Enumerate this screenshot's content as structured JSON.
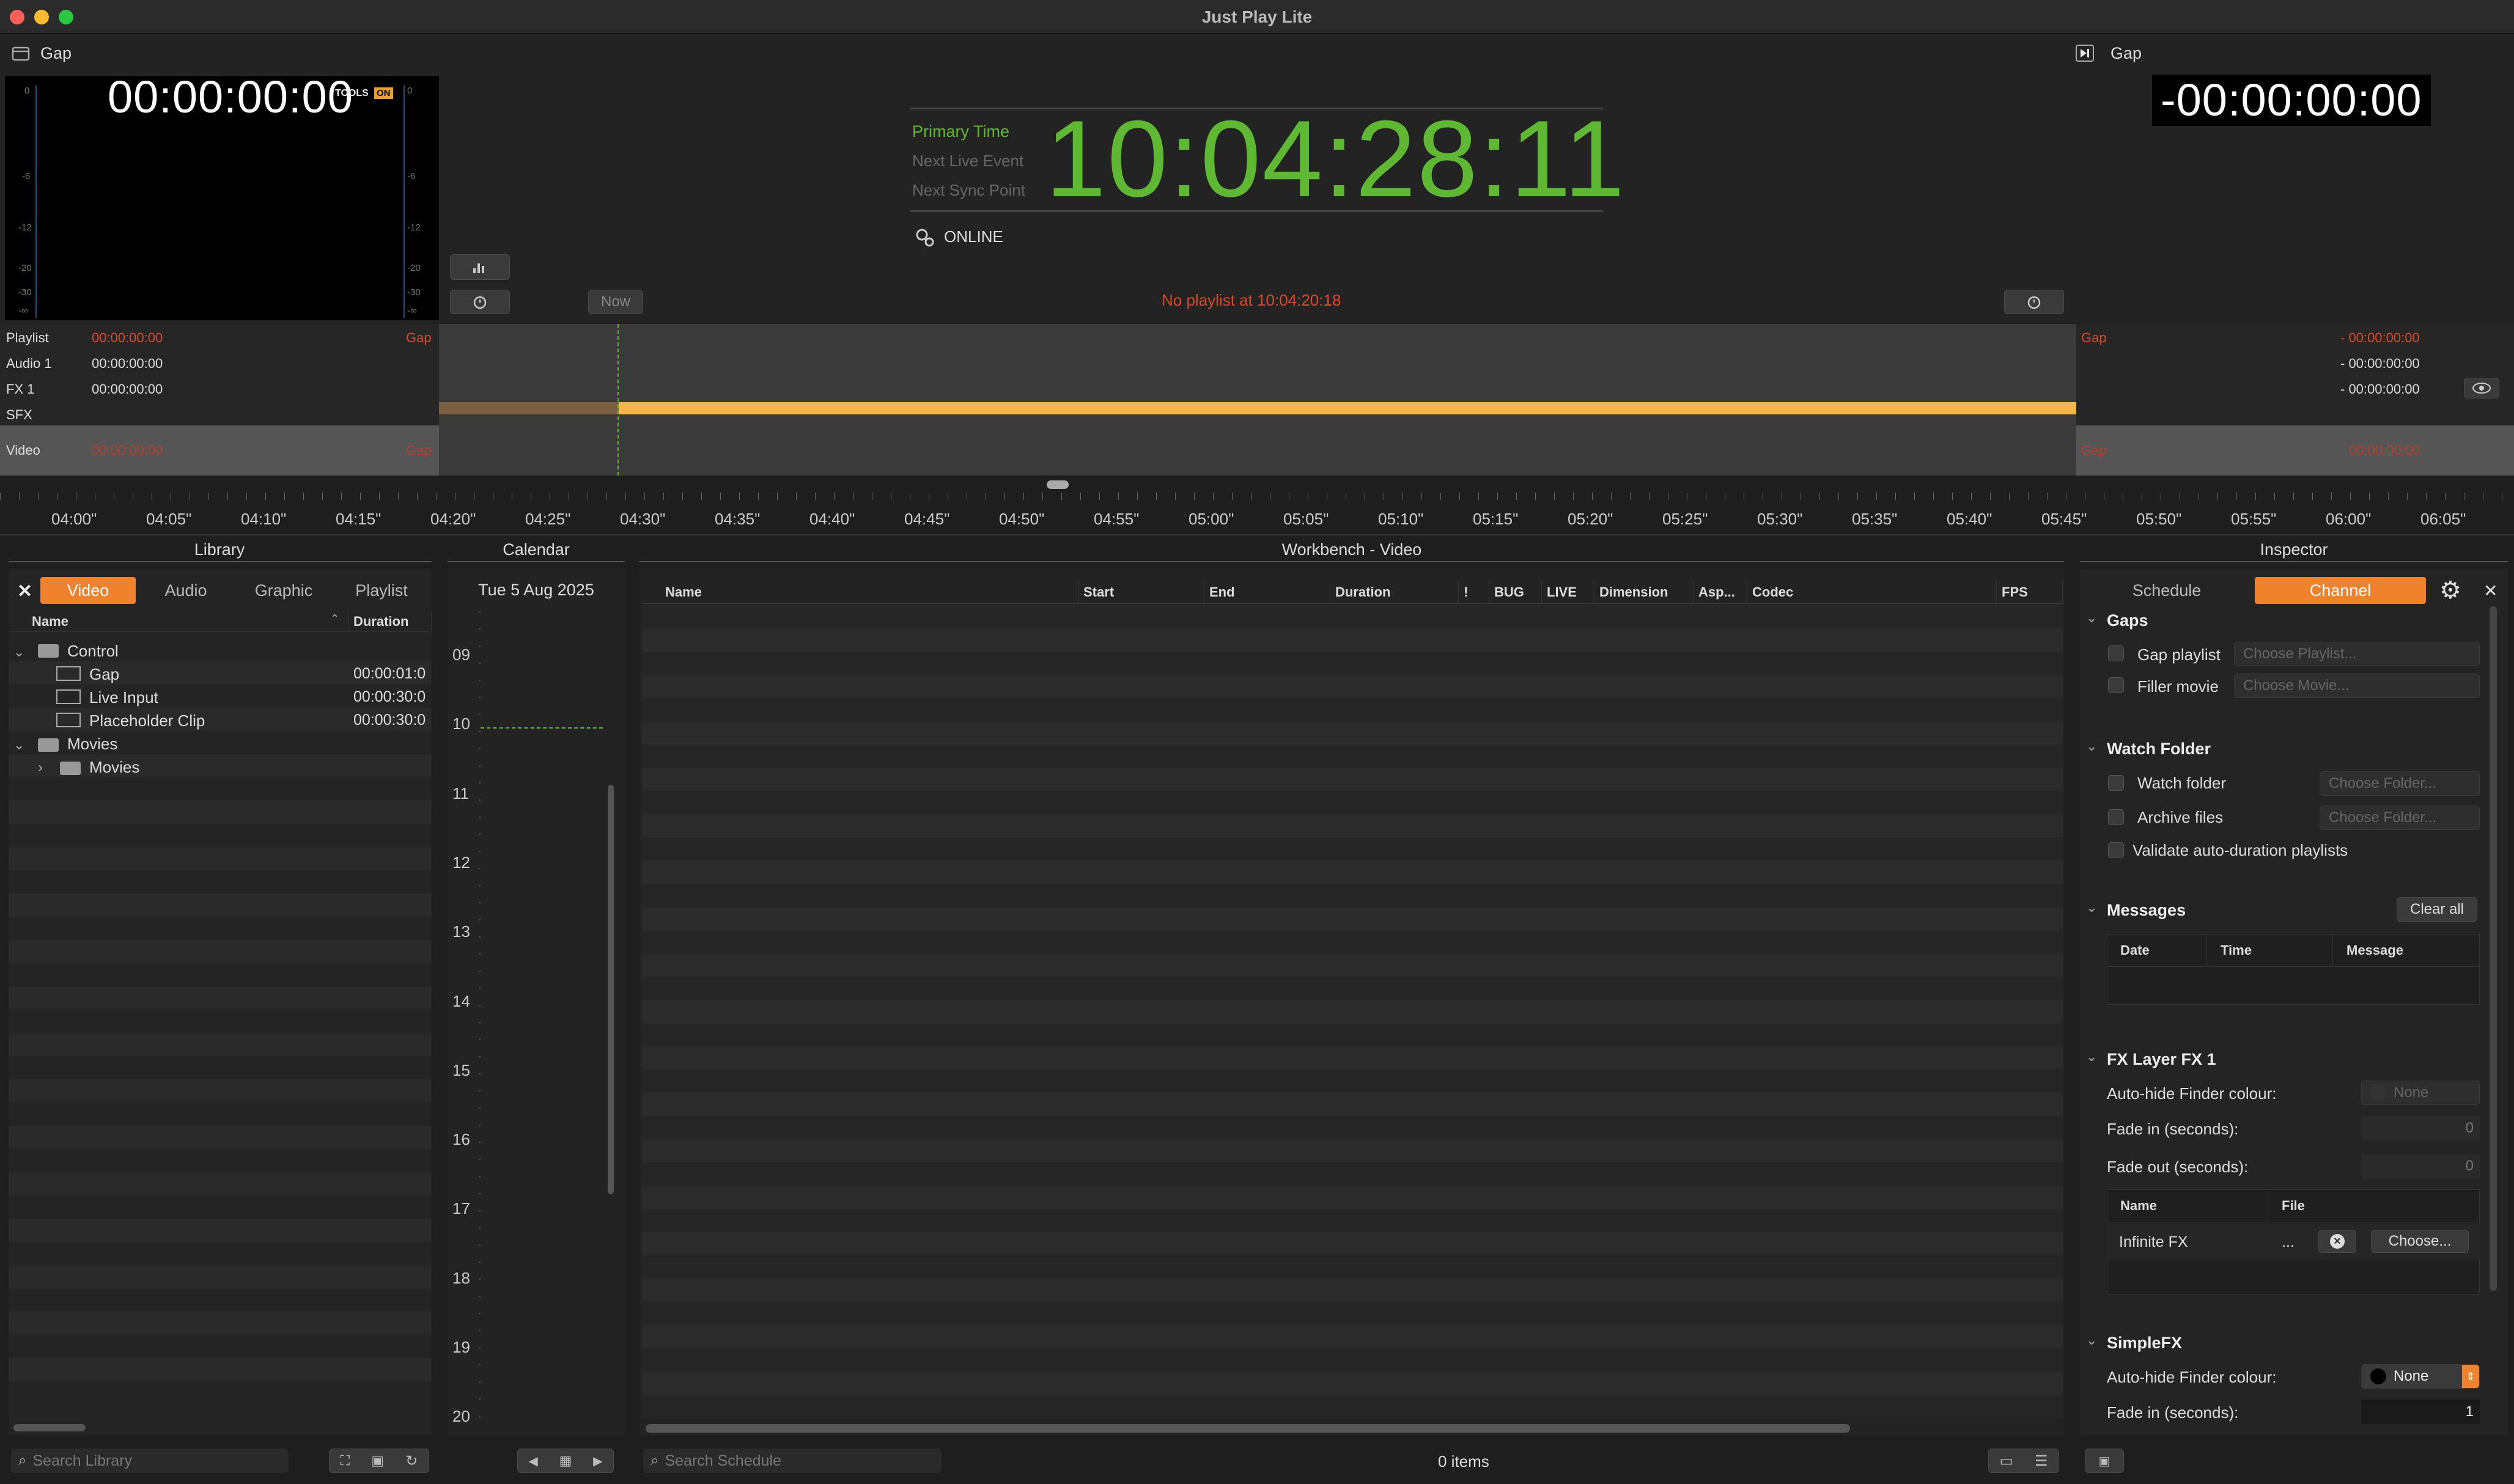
{
  "app": {
    "title": "Just Play Lite"
  },
  "header": {
    "left": {
      "label": "Gap",
      "timecode": "00:00:00:00",
      "tools": "TOOLS",
      "on": "ON",
      "scale": [
        "0",
        "-6",
        "-12",
        "-20",
        "-30",
        "-∞"
      ]
    },
    "center": {
      "primary_label": "Primary Time",
      "next_live_label": "Next Live Event",
      "next_sync_label": "Next Sync Point",
      "clock": "10:04:28:11",
      "status": "ONLINE"
    },
    "right": {
      "label": "Gap",
      "timecode": "-00:00:00:00"
    },
    "now_button": "Now",
    "no_playlist": "No playlist at 10:04:20:18"
  },
  "tracks": [
    {
      "name": "Playlist",
      "time": "00:00:00:00",
      "gap": "Gap",
      "right_gap": "Gap",
      "right_time": "- 00:00:00:00"
    },
    {
      "name": "Audio 1",
      "time": "00:00:00:00",
      "gap": "",
      "right_gap": "",
      "right_time": "- 00:00:00:00"
    },
    {
      "name": "FX 1",
      "time": "00:00:00:00",
      "gap": "",
      "right_gap": "",
      "right_time": "- 00:00:00:00"
    },
    {
      "name": "SFX",
      "time": "",
      "gap": "",
      "right_gap": "",
      "right_time": ""
    },
    {
      "name": "Video",
      "time": "00:00:00:00",
      "gap": "Gap",
      "right_gap": "Gap",
      "right_time": "00:00:00:00"
    }
  ],
  "ruler": [
    "04:00\"",
    "04:05\"",
    "04:10\"",
    "04:15\"",
    "04:20\"",
    "04:25\"",
    "04:30\"",
    "04:35\"",
    "04:40\"",
    "04:45\"",
    "04:50\"",
    "04:55\"",
    "05:00\"",
    "05:05\"",
    "05:10\"",
    "05:15\"",
    "05:20\"",
    "05:25\"",
    "05:30\"",
    "05:35\"",
    "05:40\"",
    "05:45\"",
    "05:50\"",
    "05:55\"",
    "06:00\"",
    "06:05\""
  ],
  "library": {
    "title": "Library",
    "tabs": [
      "Video",
      "Audio",
      "Graphic",
      "Playlist"
    ],
    "columns": [
      "Name",
      "Duration"
    ],
    "items": [
      {
        "name": "Control",
        "duration": ""
      },
      {
        "name": "Gap",
        "duration": "00:00:01:0"
      },
      {
        "name": "Live Input",
        "duration": "00:00:30:0"
      },
      {
        "name": "Placeholder Clip",
        "duration": "00:00:30:0"
      },
      {
        "name": "Movies",
        "duration": ""
      },
      {
        "name": "Movies",
        "duration": ""
      }
    ],
    "search_placeholder": "Search Library"
  },
  "calendar": {
    "title": "Calendar",
    "date": "Tue 5 Aug 2025",
    "hours": [
      "09",
      "10",
      "11",
      "12",
      "13",
      "14",
      "15",
      "16",
      "17",
      "18",
      "19",
      "20"
    ]
  },
  "workbench": {
    "title": "Workbench - Video",
    "columns": [
      "Name",
      "Start",
      "End",
      "Duration",
      "!",
      "BUG",
      "LIVE",
      "Dimension",
      "Asp...",
      "Codec",
      "FPS"
    ],
    "search_placeholder": "Search Schedule",
    "item_count": "0 items"
  },
  "inspector": {
    "title": "Inspector",
    "tabs": [
      "Schedule",
      "Channel"
    ],
    "gaps": {
      "title": "Gaps",
      "gap_playlist": "Gap playlist",
      "choose_playlist": "Choose Playlist...",
      "filler_movie": "Filler movie",
      "choose_movie": "Choose Movie..."
    },
    "watch": {
      "title": "Watch Folder",
      "watch_folder": "Watch folder",
      "choose_folder1": "Choose Folder...",
      "archive": "Archive files",
      "choose_folder2": "Choose Folder...",
      "validate": "Validate auto-duration playlists"
    },
    "messages": {
      "title": "Messages",
      "clear": "Clear all",
      "columns": [
        "Date",
        "Time",
        "Message"
      ]
    },
    "fx1": {
      "title": "FX Layer FX 1",
      "auto_hide": "Auto-hide Finder colour:",
      "none": "None",
      "fade_in": "Fade in (seconds):",
      "fade_in_val": "0",
      "fade_out": "Fade out (seconds):",
      "fade_out_val": "0",
      "columns": [
        "Name",
        "File"
      ],
      "row_name": "Infinite FX",
      "row_dots": "...",
      "choose": "Choose..."
    },
    "simplefx": {
      "title": "SimpleFX",
      "auto_hide": "Auto-hide Finder colour:",
      "none": "None",
      "fade_in": "Fade in (seconds):",
      "fade_in_val": "1"
    }
  },
  "colors": {
    "accent": "#f0822d",
    "green": "#5fb832",
    "red": "#d84a2a",
    "bar": "#f2b547"
  }
}
